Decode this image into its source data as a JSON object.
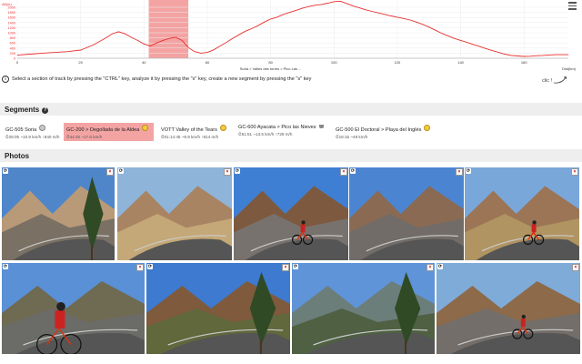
{
  "chart_data": {
    "type": "area",
    "ylabel": "Alt(m)",
    "yticks": [
      "2000",
      "1800",
      "1600",
      "1400",
      "1200",
      "1000",
      "800",
      "600",
      "400",
      "200",
      "0"
    ],
    "xticks": [
      "0",
      "20",
      "40",
      "60",
      "80",
      "100",
      "120",
      "140",
      "160"
    ],
    "xlabel_right": "Dist(km)",
    "track_label": "Soria > Valles des torres > Pico Las ...",
    "xlim": [
      0,
      174
    ],
    "ylim": [
      0,
      2000
    ],
    "highlight_range": [
      41.5,
      54
    ],
    "line_color": "#e83030",
    "highlight_color": "#f4a3a3",
    "x": [
      0,
      4,
      8,
      12,
      16,
      20,
      24,
      28,
      30,
      32,
      34,
      36,
      38,
      40,
      42,
      44,
      46,
      48,
      50,
      52,
      54,
      56,
      58,
      60,
      62,
      64,
      66,
      68,
      70,
      72,
      74,
      76,
      78,
      80,
      82,
      84,
      86,
      88,
      90,
      92,
      94,
      96,
      98,
      100,
      102,
      104,
      106,
      108,
      110,
      112,
      114,
      116,
      118,
      120,
      122,
      124,
      126,
      128,
      130,
      132,
      134,
      136,
      138,
      140,
      142,
      144,
      146,
      148,
      150,
      152,
      154,
      156,
      158,
      160,
      162,
      164,
      166,
      168,
      170,
      172,
      174
    ],
    "y": [
      120,
      160,
      200,
      230,
      260,
      320,
      520,
      800,
      960,
      1040,
      960,
      820,
      700,
      560,
      480,
      600,
      700,
      780,
      820,
      700,
      420,
      260,
      200,
      230,
      330,
      480,
      620,
      780,
      920,
      1060,
      1160,
      1280,
      1420,
      1540,
      1610,
      1720,
      1800,
      1880,
      1960,
      2030,
      2080,
      2110,
      2160,
      2220,
      2240,
      2150,
      2050,
      1980,
      1900,
      1840,
      1780,
      1720,
      1660,
      1610,
      1560,
      1500,
      1420,
      1330,
      1220,
      1100,
      980,
      880,
      780,
      700,
      620,
      540,
      460,
      380,
      300,
      230,
      160,
      110,
      90,
      70,
      80,
      100,
      110,
      130,
      140,
      140,
      140
    ]
  },
  "hint": "Select a section of track by pressing the \"CTRL\" key, analyze it by pressing the \"x\" key, create a new segment by pressing the \"s\" key",
  "clic_label": "clic !",
  "segments_header": "Segments",
  "photos_header": "Photos",
  "segments": [
    {
      "name": "GC-505 Soria",
      "stats": "⏱28:05 ~10.9 km/h ↑840 m/h",
      "medal": "silver"
    },
    {
      "name": "GC-200 > Degollada de la Aldea",
      "stats": "⏱44:25 ~17.6 km/h",
      "medal": "gold"
    },
    {
      "name": "VOTT Valley of the Tears",
      "stats": "⏱01:14:45 ~9.9 km/h ↑814 m/h",
      "medal": "gold"
    },
    {
      "name": "GC-600 Ayacata > Pico las Nieves",
      "stats": "⏱51:51 ~13.5 km/h ↑729 m/h",
      "medal": "trophy"
    },
    {
      "name": "GC-500 El Doctoral > Playa del Inglés",
      "stats": "⏱18:16 ~48 km/h",
      "medal": "gold"
    }
  ],
  "photos": [
    {
      "kind": "canyon-road-pines"
    },
    {
      "kind": "dry-slope-grass"
    },
    {
      "kind": "cyclist-peak-road"
    },
    {
      "kind": "mountain-road-barrier"
    },
    {
      "kind": "cyclist-hairpin"
    },
    {
      "kind": "cyclist-closeup"
    },
    {
      "kind": "pine-rock-road"
    },
    {
      "kind": "valley-pine-panorama"
    },
    {
      "kind": "cyclist-switchback"
    }
  ]
}
